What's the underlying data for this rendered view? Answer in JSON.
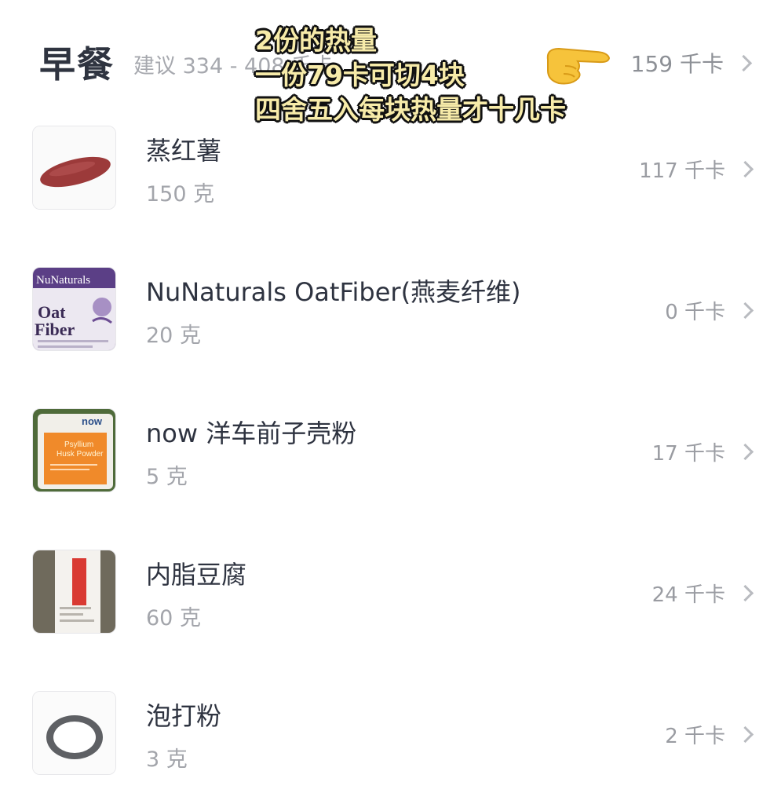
{
  "header": {
    "meal_title": "早餐",
    "suggestion": "建议 334 - 408 千卡",
    "total": "159 千卡"
  },
  "overlay_note": {
    "line1": "2份的热量",
    "line2": "一份79卡可切4块",
    "line3": "四舍五入每块热量才十几卡"
  },
  "foods": [
    {
      "name": "蒸红薯",
      "amount": "150 克",
      "kcal": "117 千卡",
      "image": "sweet-potato"
    },
    {
      "name": "NuNaturals OatFiber(燕麦纤维)",
      "amount": "20 克",
      "kcal": "0 千卡",
      "image": "oat-fiber-bag",
      "image_text": {
        "brand": "NuNaturals",
        "line1": "Oat",
        "line2": "Fiber"
      }
    },
    {
      "name": "now 洋车前子壳粉",
      "amount": "5 克",
      "kcal": "17 千卡",
      "image": "psyllium-bag",
      "image_text": {
        "brand": "now",
        "line1": "Psyllium",
        "line2": "Husk Powder"
      }
    },
    {
      "name": "内脂豆腐",
      "amount": "60 克",
      "kcal": "24 千卡",
      "image": "tofu-pack"
    },
    {
      "name": "泡打粉",
      "amount": "3 克",
      "kcal": "2 千卡",
      "image": "baking-powder"
    }
  ],
  "colors": {
    "title": "#2f3440",
    "secondary": "#a3a5ab",
    "chevron": "#b9bbc0",
    "note_fill": "#f7eba9"
  }
}
